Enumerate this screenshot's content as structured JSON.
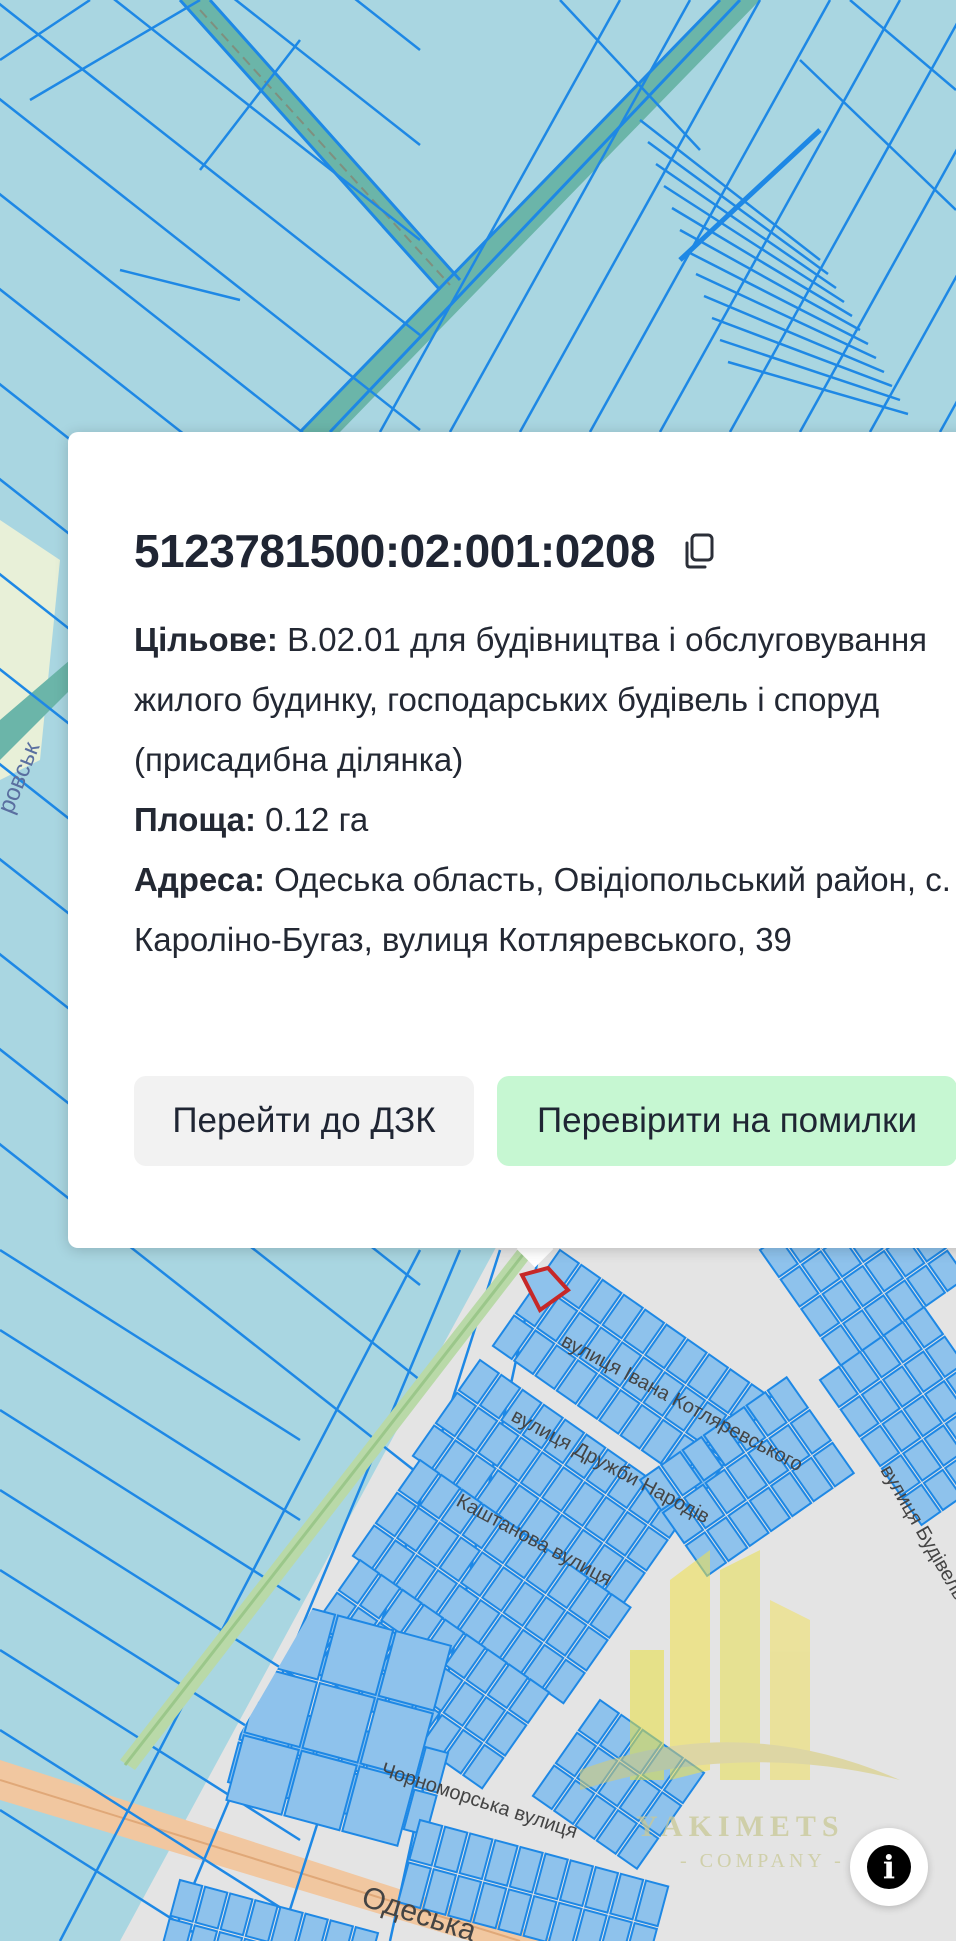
{
  "map": {
    "street_labels": [
      "вулиця Івана Котляревського",
      "вулиця Дружби Народів",
      "Каштанова вулиця",
      "вулиця Будівельна",
      "Чорноморська вулиця",
      "Одеська",
      "ровськ"
    ],
    "colors": {
      "parcel_fill": "#a9d6e1",
      "parcel_stroke": "#1e88e5",
      "selected_parcel_stroke": "#c62828",
      "road_fill": "#6bb5a9",
      "main_road": "#f1c7a0",
      "urban_fill": "#8ec2ec",
      "base_gray": "#e6e6e6"
    }
  },
  "popup": {
    "cadastral_number": "5123781500:02:001:0208",
    "copy_icon": "copy-icon",
    "purpose_label": "Цільове:",
    "purpose_value": "В.02.01 для будівництва і обслуговування жилого будинку, господарських будівель і споруд (присадибна ділянка)",
    "area_label": "Площа:",
    "area_value": "0.12 га",
    "address_label": "Адреса:",
    "address_value": "Одеська область, Овідіопольський район, с. Кароліно-Бугаз, вулиця Котляревського, 39",
    "btn_dzk": "Перейти до ДЗК",
    "btn_check": "Перевірити на помилки"
  },
  "watermark": {
    "name": "YAKIMETS",
    "sub": "- COMPANY -"
  },
  "info_button": {
    "icon": "info-icon",
    "glyph": "i"
  }
}
